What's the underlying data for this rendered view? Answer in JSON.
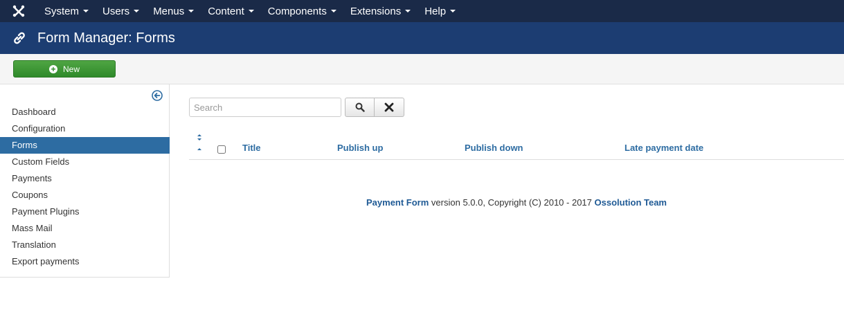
{
  "topnav": {
    "logo_icon": "joomla-logo-icon",
    "items": [
      {
        "label": "System"
      },
      {
        "label": "Users"
      },
      {
        "label": "Menus"
      },
      {
        "label": "Content"
      },
      {
        "label": "Components"
      },
      {
        "label": "Extensions"
      },
      {
        "label": "Help"
      }
    ]
  },
  "header": {
    "icon": "link-icon",
    "title": "Form Manager: Forms"
  },
  "toolbar": {
    "new_label": "New"
  },
  "sidebar": {
    "collapse_icon": "arrow-left-circle-icon",
    "items": [
      {
        "label": "Dashboard"
      },
      {
        "label": "Configuration"
      },
      {
        "label": "Forms",
        "active": true
      },
      {
        "label": "Custom Fields"
      },
      {
        "label": "Payments"
      },
      {
        "label": "Coupons"
      },
      {
        "label": "Payment Plugins"
      },
      {
        "label": "Mass Mail"
      },
      {
        "label": "Translation"
      },
      {
        "label": "Export payments"
      }
    ]
  },
  "search": {
    "placeholder": "Search",
    "value": ""
  },
  "table": {
    "columns": [
      {
        "label": "Title"
      },
      {
        "label": "Publish up"
      },
      {
        "label": "Publish down"
      },
      {
        "label": "Late payment date"
      }
    ],
    "rows": []
  },
  "footer": {
    "product_link": "Payment Form",
    "text": " version 5.0.0, Copyright (C) 2010 - 2017 ",
    "team_link": "Ossolution Team"
  },
  "colors": {
    "topnav_bg": "#1a2a48",
    "header_bg": "#1c3d72",
    "new_button": "#2f8a2a",
    "sidebar_active": "#2d6ca2",
    "link": "#2d6ca2"
  }
}
